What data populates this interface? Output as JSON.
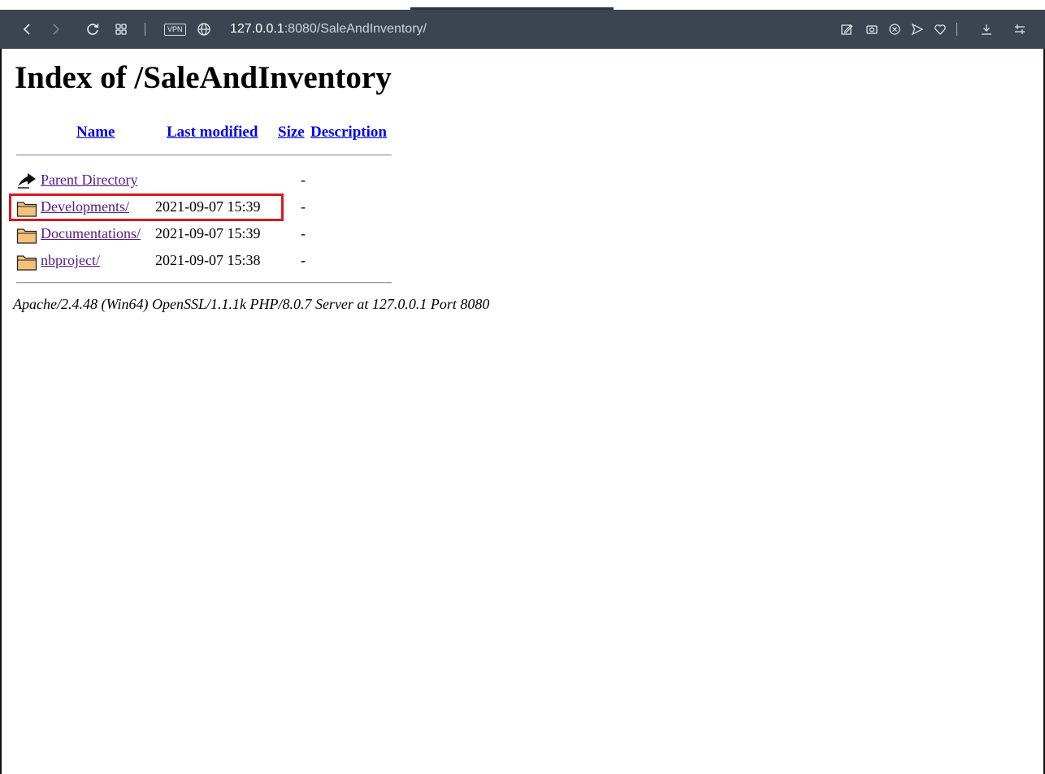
{
  "browser": {
    "vpn_label": "VPN",
    "address_host": "127.0.0.1",
    "address_rest": ":8080/SaleAndInventory/"
  },
  "page": {
    "title": "Index of /SaleAndInventory",
    "columns": {
      "name": "Name",
      "last_modified": "Last modified",
      "size": "Size",
      "description": "Description"
    },
    "rows": [
      {
        "icon": "parent-directory-icon",
        "name": "Parent Directory",
        "date": "",
        "size": "-"
      },
      {
        "icon": "folder-icon",
        "name": "Developments/",
        "date": "2021-09-07 15:39",
        "size": "-"
      },
      {
        "icon": "folder-icon",
        "name": "Documentations/",
        "date": "2021-09-07 15:39",
        "size": "-"
      },
      {
        "icon": "folder-icon",
        "name": "nbproject/",
        "date": "2021-09-07 15:38",
        "size": "-"
      }
    ],
    "footer": "Apache/2.4.48 (Win64) OpenSSL/1.1.1k PHP/8.0.7 Server at 127.0.0.1 Port 8080"
  },
  "colors": {
    "toolbar_bg": "#3b4552",
    "link": "#0000ee",
    "visited_link": "#551a8b",
    "highlight_box": "#d7191f"
  }
}
